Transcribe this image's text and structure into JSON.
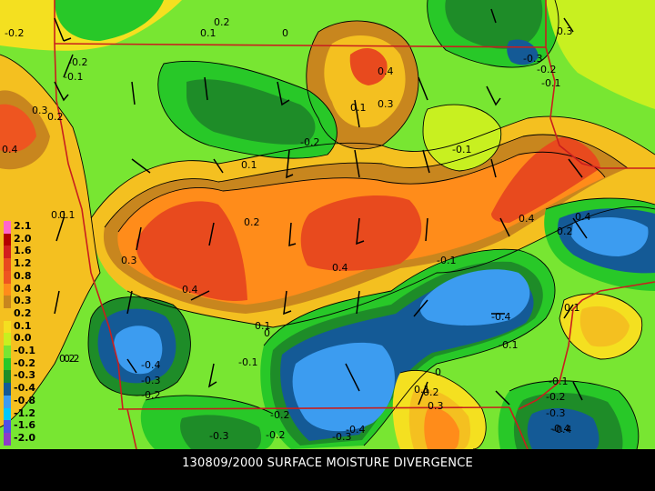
{
  "caption": "130809/2000 SURFACE MOISTURE DIVERGENCE",
  "legend": {
    "items": [
      {
        "label": "2.1",
        "color": "#ff66cc"
      },
      {
        "label": "2.0",
        "color": "#b40000"
      },
      {
        "label": "1.6",
        "color": "#d21e1e"
      },
      {
        "label": "1.2",
        "color": "#e84a1e"
      },
      {
        "label": "0.8",
        "color": "#ee5520"
      },
      {
        "label": "0.4",
        "color": "#ff8c1a"
      },
      {
        "label": "0.3",
        "color": "#c8861e"
      },
      {
        "label": "0.2",
        "color": "#f4c020"
      },
      {
        "label": "0.1",
        "color": "#f4e020"
      },
      {
        "label": "0.0",
        "color": "#c8f020"
      },
      {
        "label": "-0.1",
        "color": "#78e632"
      },
      {
        "label": "-0.2",
        "color": "#28c828"
      },
      {
        "label": "-0.3",
        "color": "#1e8c28"
      },
      {
        "label": "-0.4",
        "color": "#145a96"
      },
      {
        "label": "-0.8",
        "color": "#3c9cf0"
      },
      {
        "label": "-1.2",
        "color": "#00c8ff"
      },
      {
        "label": "-1.6",
        "color": "#5050e6"
      },
      {
        "label": "-2.0",
        "color": "#8c3cc8"
      }
    ]
  },
  "contour_labels": [
    "-0.2",
    "0.2",
    "0.1",
    "0",
    "-0.2",
    "-0.1",
    "0.4",
    "-0.3",
    "-0.2",
    "-0.1",
    "0.3",
    "0.2",
    "0.3",
    "0.4",
    "0.1",
    "0.3",
    "-0.2",
    "-0.1",
    "0.1",
    "0.1",
    "0.2",
    "0.4",
    "0.4",
    "0.3",
    "0.4",
    "0.2",
    "0.1",
    "0",
    "0.1",
    "0.2",
    "0.4",
    "-0.1",
    "-0.4",
    "-0.4",
    "-0.3",
    "-0.2",
    "0.2",
    "-0.1",
    "-0.4",
    "-0.1",
    "-0.2",
    "-0.3",
    "-0.4",
    "0.1",
    "0.2",
    "0.3",
    "-0.3",
    "-0.2",
    "0",
    "-0.1",
    "-0.2",
    "-0.3",
    "-0.4",
    "0.1"
  ],
  "colors": {
    "boundary": "#c81e1e",
    "contour": "#000000",
    "wind": "#000000"
  }
}
